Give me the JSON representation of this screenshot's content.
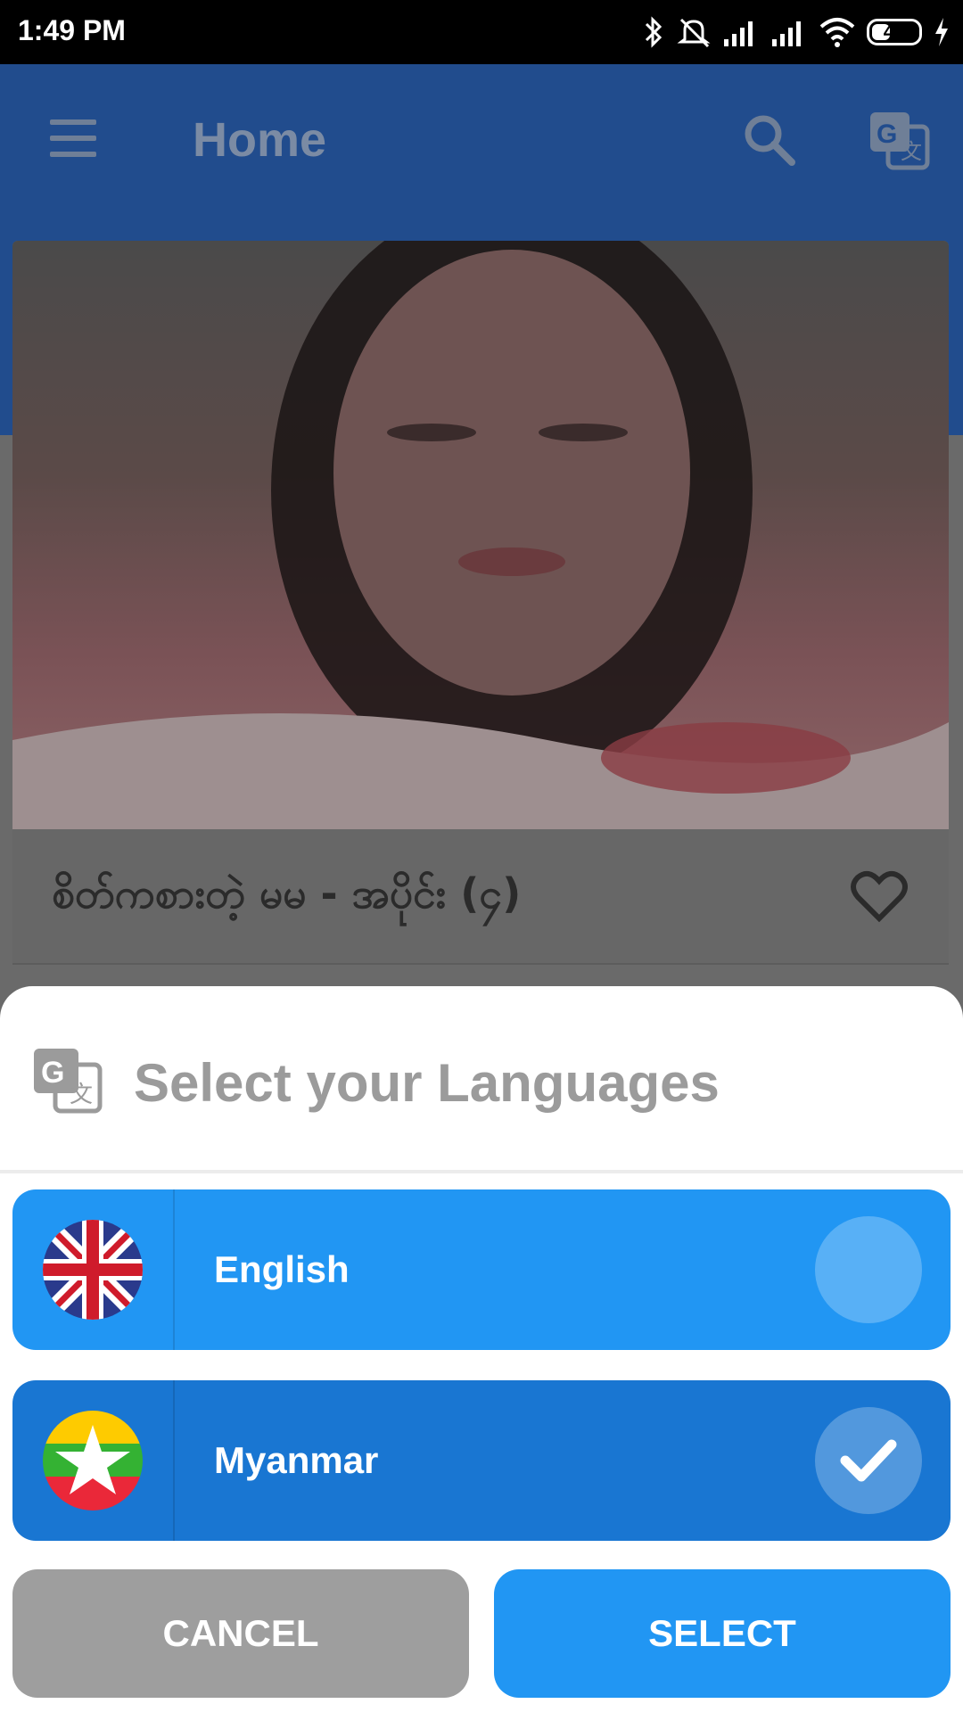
{
  "status_bar": {
    "time": "1:49 PM",
    "battery_level": "40",
    "icons": [
      "bluetooth-icon",
      "mute-icon",
      "signal-icon",
      "signal-icon",
      "wifi-icon",
      "battery-icon",
      "charging-icon"
    ]
  },
  "app_bar": {
    "title": "Home",
    "icons": [
      "menu-icon",
      "search-icon",
      "translate-icon"
    ]
  },
  "card": {
    "title": "စိတ်ကစားတဲ့ မမ - အပိုင်း (၄)",
    "icons": [
      "heart-icon"
    ]
  },
  "dialog": {
    "title": "Select your Languages",
    "icon": "translate-icon",
    "options": [
      {
        "label": "English",
        "flag": "uk-flag-icon",
        "selected": false
      },
      {
        "label": "Myanmar",
        "flag": "myanmar-flag-icon",
        "selected": true
      }
    ],
    "cancel_label": "CANCEL",
    "select_label": "SELECT"
  },
  "colors": {
    "app_bar": "#1E4A8A",
    "option_english": "#2196F3",
    "option_myanmar": "#1976D2",
    "cancel": "#9E9E9E",
    "select": "#2196F3"
  }
}
